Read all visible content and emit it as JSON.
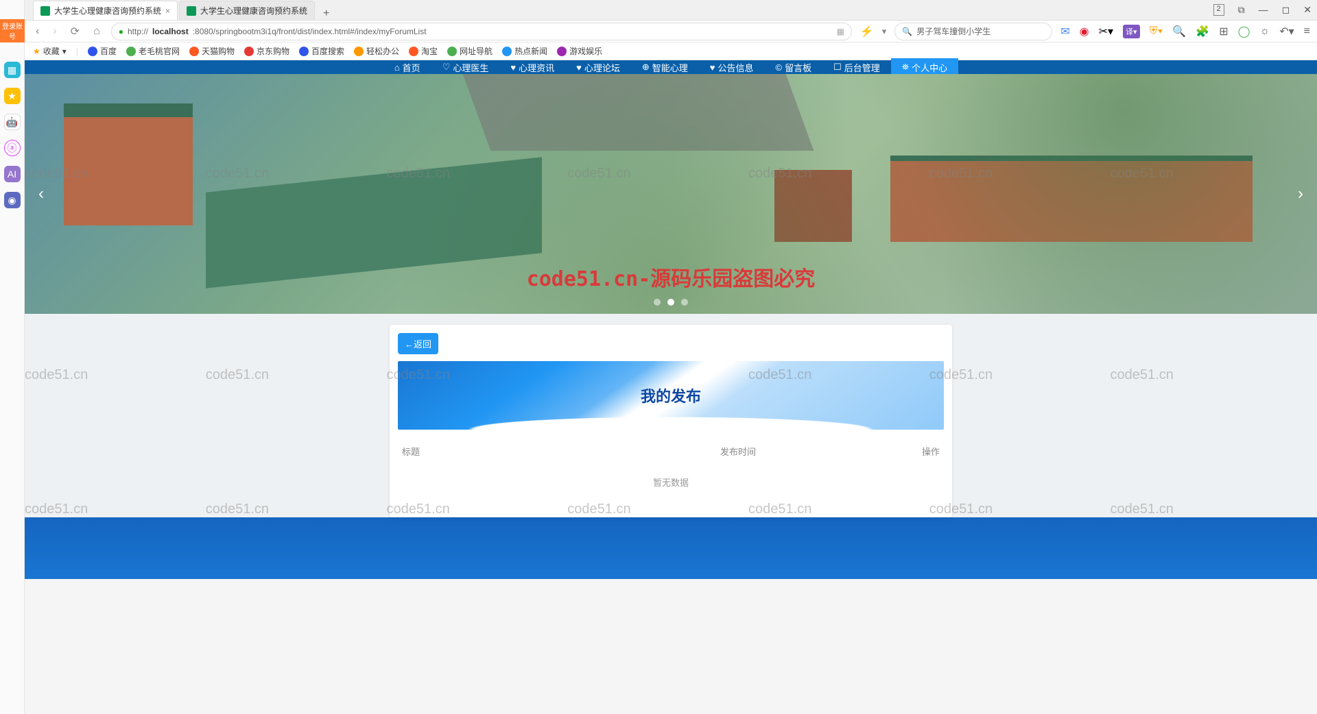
{
  "tabs": [
    {
      "title": "大学生心理健康咨询预约系统",
      "active": true
    },
    {
      "title": "大学生心理健康咨询预约系统",
      "active": false
    }
  ],
  "window_badge": "2",
  "address": {
    "host": "localhost",
    "url_prefix": "http://",
    "url_port_path": ":8080/springbootm3i1q/front/dist/index.html#/index/myForumList"
  },
  "search": {
    "placeholder": "男子驾车撞倒小学生"
  },
  "bookmarks": {
    "fav": "收藏",
    "items": [
      "百度",
      "老毛桃官网",
      "天猫购物",
      "京东购物",
      "百度搜索",
      "轻松办公",
      "淘宝",
      "网址导航",
      "热点新闻",
      "游戏娱乐"
    ]
  },
  "login_badge": "登录账号",
  "nav": {
    "items": [
      {
        "icon": "⌂",
        "label": "首页"
      },
      {
        "icon": "♡",
        "label": "心理医生"
      },
      {
        "icon": "♥",
        "label": "心理资讯"
      },
      {
        "icon": "♥",
        "label": "心理论坛"
      },
      {
        "icon": "⊕",
        "label": "智能心理"
      },
      {
        "icon": "♥",
        "label": "公告信息"
      },
      {
        "icon": "©",
        "label": "留言板"
      },
      {
        "icon": "☐",
        "label": "后台管理"
      },
      {
        "icon": "⛯",
        "label": "个人中心",
        "active": true
      }
    ]
  },
  "banner": {
    "watermark_center": "code51.cn-源码乐园盗图必究",
    "watermark_text": "code51.cn"
  },
  "card": {
    "back_label": "←返回",
    "title": "我的发布",
    "columns": {
      "title": "标题",
      "time": "发布时间",
      "op": "操作"
    },
    "empty": "暂无数据"
  },
  "toolbar_right": {
    "lightning": "⚡",
    "mail_color": "#ff5722",
    "weibo_color": "#e6162d",
    "scissors": "✂",
    "purple": "#7e57c2",
    "shield_color": "#ffa000"
  }
}
